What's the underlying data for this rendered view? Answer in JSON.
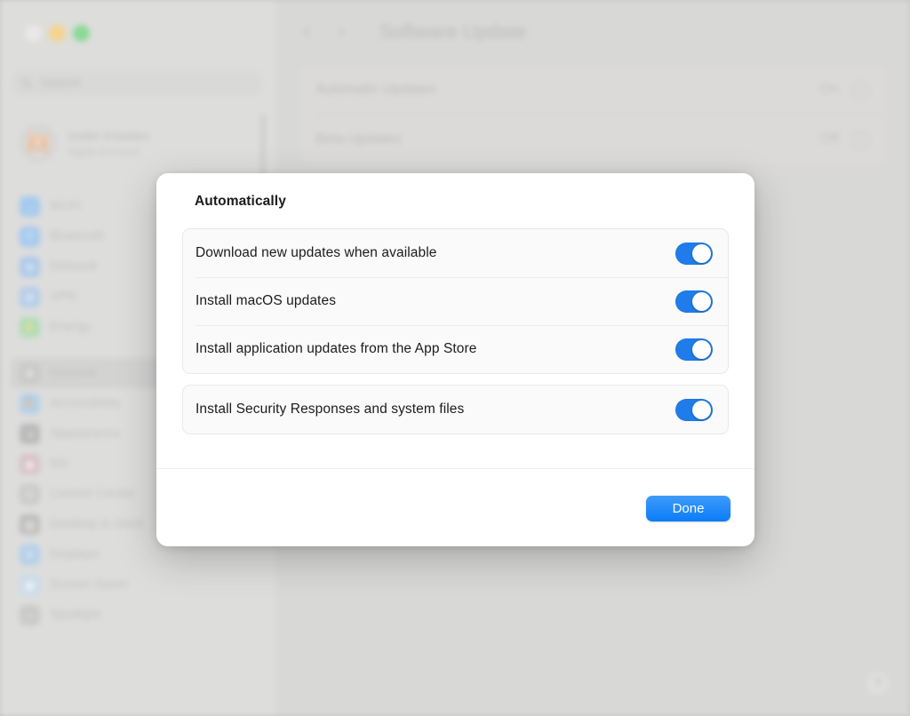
{
  "window": {
    "traffic_lights": [
      {
        "name": "close",
        "color": "#e6e4e2"
      },
      {
        "name": "minimize",
        "color": "#febc2e"
      },
      {
        "name": "maximize",
        "color": "#28c840"
      }
    ]
  },
  "sidebar": {
    "search": {
      "placeholder": "Search",
      "value": ""
    },
    "account": {
      "name": "Ivelin Krastev",
      "subtitle": "Apple Account",
      "avatar_glyph": "🐹"
    },
    "groups": [
      {
        "items": [
          {
            "label": "Wi-Fi",
            "icon": "wifi-icon",
            "glyph": "◞",
            "color": "#5ea8f0",
            "selected": false
          },
          {
            "label": "Bluetooth",
            "icon": "bluetooth-icon",
            "glyph": "ᛗ",
            "color": "#5ea8f0",
            "selected": false
          },
          {
            "label": "Network",
            "icon": "globe-icon",
            "glyph": "⊕",
            "color": "#6fa9e8",
            "selected": false
          },
          {
            "label": "VPN",
            "icon": "vpn-icon",
            "glyph": "⊕",
            "color": "#7eb1e6",
            "selected": false
          },
          {
            "label": "Energy",
            "icon": "bolt-icon",
            "glyph": "⚡",
            "color": "#77cf83",
            "selected": false
          }
        ]
      },
      {
        "items": [
          {
            "label": "General",
            "icon": "gear-icon",
            "glyph": "⚙",
            "color": "#a7a6a5",
            "selected": true
          },
          {
            "label": "Accessibility",
            "icon": "accessibility-icon",
            "glyph": "⛹",
            "color": "#7fb4e8",
            "selected": false
          },
          {
            "label": "Appearance",
            "icon": "appearance-icon",
            "glyph": "◑",
            "color": "#8a8988",
            "selected": false
          },
          {
            "label": "Siri",
            "icon": "siri-icon",
            "glyph": "◉",
            "color": "#c49aa8",
            "selected": false
          },
          {
            "label": "Control Center",
            "icon": "control-center-icon",
            "glyph": "☷",
            "color": "#a9a8a7",
            "selected": false
          },
          {
            "label": "Desktop & Dock",
            "icon": "desktop-dock-icon",
            "glyph": "▤",
            "color": "#8e8d8c",
            "selected": false
          },
          {
            "label": "Displays",
            "icon": "displays-icon",
            "glyph": "☀",
            "color": "#7fb4e8",
            "selected": false
          },
          {
            "label": "Screen Saver",
            "icon": "screen-saver-icon",
            "glyph": "▣",
            "color": "#a9cdec",
            "selected": false
          },
          {
            "label": "Spotlight",
            "icon": "spotlight-icon",
            "glyph": "⌕",
            "color": "#a9a8a7",
            "selected": false
          }
        ]
      }
    ]
  },
  "main": {
    "back_icon": "chevron-left-icon",
    "forward_icon": "chevron-right-icon",
    "title": "Software Update",
    "rows": [
      {
        "label": "Automatic Updates",
        "value": "On",
        "info_icon": "info-icon"
      },
      {
        "label": "Beta Updates",
        "value": "Off",
        "info_icon": "info-icon"
      }
    ],
    "help_label": "?"
  },
  "sheet": {
    "title": "Automatically",
    "primary_group": [
      {
        "label": "Download new updates when available",
        "state": "on"
      },
      {
        "label": "Install macOS updates",
        "state": "on"
      },
      {
        "label": "Install application updates from the App Store",
        "state": "on"
      }
    ],
    "secondary_group": [
      {
        "label": "Install Security Responses and system files",
        "state": "on"
      }
    ],
    "done_label": "Done"
  },
  "colors": {
    "accent": "#1f7ce8",
    "done_button": "#0a7cf8",
    "window_background": "#c7c6c6",
    "sheet_background": "#ffffff",
    "card_background": "#fafafa"
  }
}
